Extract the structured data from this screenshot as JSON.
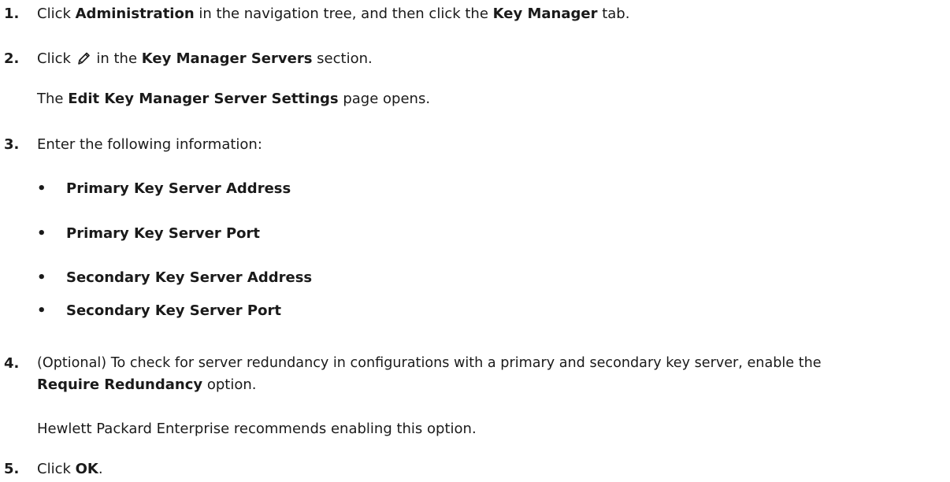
{
  "steps": [
    {
      "number": "1.",
      "parts": [
        "Click ",
        "Administration",
        " in the navigation tree, and then click the ",
        "Key Manager",
        " tab."
      ]
    },
    {
      "number": "2.",
      "parts": [
        "Click ",
        " in the ",
        "Key Manager Servers",
        " section."
      ],
      "note_parts": [
        "The ",
        "Edit Key Manager Server Settings",
        " page opens."
      ]
    },
    {
      "number": "3.",
      "text": "Enter the following information:",
      "bullets": [
        "Primary Key Server Address",
        "Primary Key Server Port",
        "Secondary Key Server Address",
        "Secondary Key Server Port"
      ]
    },
    {
      "number": "4.",
      "line1": "(Optional) To check for server redundancy in configurations with a primary and secondary key server, enable the",
      "line2_parts": [
        "Require Redundancy",
        " option."
      ],
      "note": "Hewlett Packard Enterprise recommends enabling this option."
    },
    {
      "number": "5.",
      "parts": [
        "Click ",
        "OK",
        "."
      ]
    }
  ],
  "icons": {
    "edit": "pencil-edit-icon"
  },
  "bullet_glyph": "•"
}
